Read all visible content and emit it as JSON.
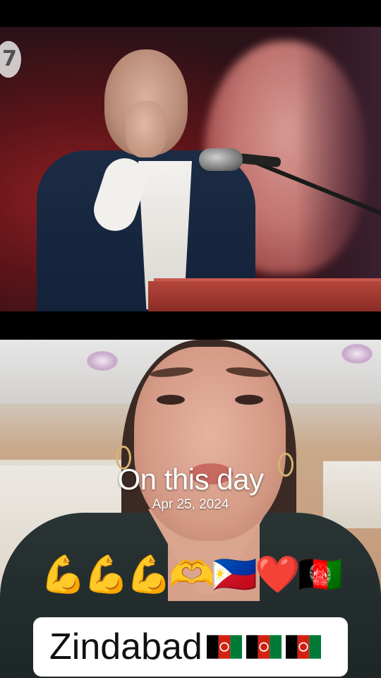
{
  "overlay": {
    "title": "On this day",
    "date": "Apr 25, 2024",
    "emoji_row": "💪💪💪🫶🇵🇭❤️🇦🇫"
  },
  "caption": {
    "text": "Zindabad",
    "flags": [
      "af-flag",
      "af-flag",
      "af-flag"
    ]
  },
  "top_video": {
    "channel_logo": "7"
  },
  "colors": {
    "background": "#000000",
    "caption_box": "#ffffff",
    "caption_text": "#111111",
    "overlay_text": "#ffffff"
  }
}
